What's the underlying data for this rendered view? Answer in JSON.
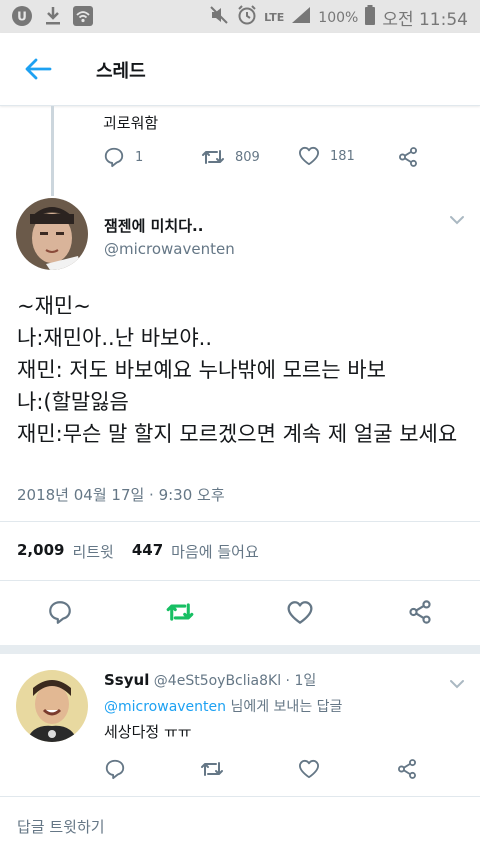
{
  "status_bar": {
    "battery": "100%",
    "network": "LTE",
    "time": "오전 11:54"
  },
  "app_bar": {
    "title": "스레드"
  },
  "previous_tweet": {
    "text": "괴로워함",
    "reply_count": "1",
    "retweet_count": "809",
    "like_count": "181"
  },
  "main_tweet": {
    "name": "잼젠에 미치다..",
    "handle": "@microwaventen",
    "body": "~재민~\n나:재민아..난 바보야..\n재민: 저도 바보예요 누나밖에 모르는 바보\n나:(할말잃음\n재민:무슨 말 할지 모르겠으면 계속 제 얼굴 보세요",
    "date": "2018년 04월 17일 · 9:30 오후",
    "retweets_count": "2,009",
    "retweets_label": "리트윗",
    "likes_count": "447",
    "likes_label": "마음에 들어요"
  },
  "reply": {
    "name": "Ssyul",
    "handle": "@4eSt5oyBclia8Kl",
    "time": " · 1일",
    "reply_to_handle": "@microwaventen",
    "reply_to_suffix": " 님에게 보내는 답글",
    "text": "세상다정 ㅠㅠ"
  },
  "compose": {
    "placeholder": "답글 트윗하기"
  },
  "colors": {
    "accent": "#1da1f2",
    "retweet_active": "#17bf63",
    "muted": "#657786"
  }
}
